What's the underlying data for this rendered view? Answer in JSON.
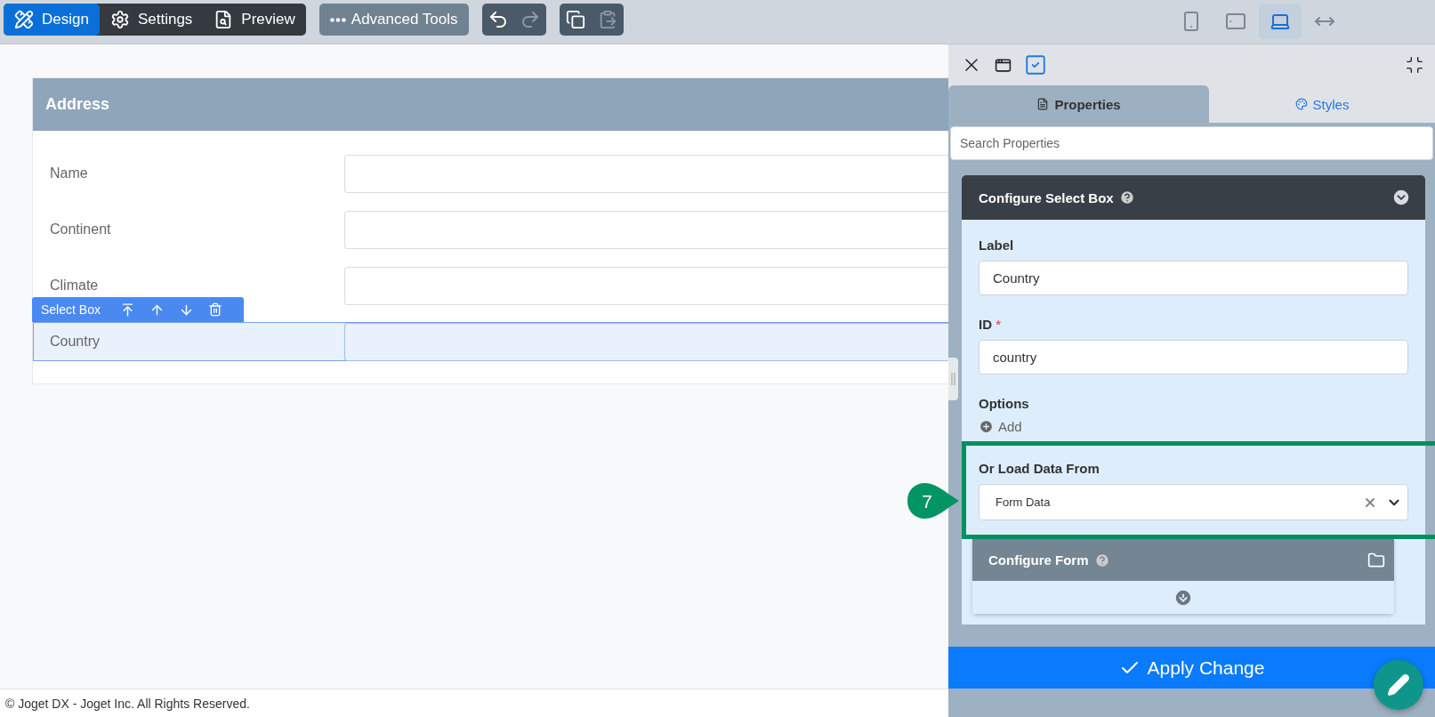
{
  "toolbar": {
    "modes": [
      {
        "kind": "design",
        "label": "Design",
        "selected": true
      },
      {
        "kind": "settings",
        "label": "Settings",
        "selected": false
      },
      {
        "kind": "preview",
        "label": "Preview",
        "selected": false
      }
    ],
    "advanced_tools": "Advanced Tools",
    "history": [
      {
        "kind": "undo",
        "disabled": false
      },
      {
        "kind": "redo",
        "disabled": true
      }
    ],
    "clipboard": [
      {
        "kind": "copy",
        "disabled": false
      },
      {
        "kind": "paste",
        "disabled": true
      }
    ],
    "devices": [
      {
        "kind": "phone",
        "selected": false
      },
      {
        "kind": "tablet",
        "selected": false
      },
      {
        "kind": "laptop",
        "selected": true
      },
      {
        "kind": "fluid",
        "selected": false
      }
    ]
  },
  "form": {
    "title": "Address",
    "element_toolbar": "Select Box",
    "fields": [
      {
        "label": "Name",
        "selected": false
      },
      {
        "label": "Continent",
        "selected": false
      },
      {
        "label": "Climate",
        "selected": false
      },
      {
        "label": "Country",
        "selected": true
      }
    ]
  },
  "footer": "© Joget DX - Joget Inc. All Rights Reserved.",
  "panel": {
    "tabs": [
      {
        "kind": "properties",
        "label": "Properties",
        "selected": true
      },
      {
        "kind": "styles",
        "label": "Styles",
        "selected": false
      }
    ],
    "search": {
      "placeholder": "Search Properties"
    },
    "section": {
      "title": "Configure Select Box",
      "fields": [
        {
          "label": "Label",
          "value": "Country"
        },
        {
          "label": "ID",
          "value": "country",
          "required_mark": "*"
        }
      ],
      "options_label": "Options",
      "add_label": "Add",
      "load_from": {
        "label": "Or Load Data From",
        "value": "Form Data",
        "callout": "7"
      },
      "subsection": {
        "title": "Configure Form"
      }
    },
    "apply": "Apply Change"
  }
}
